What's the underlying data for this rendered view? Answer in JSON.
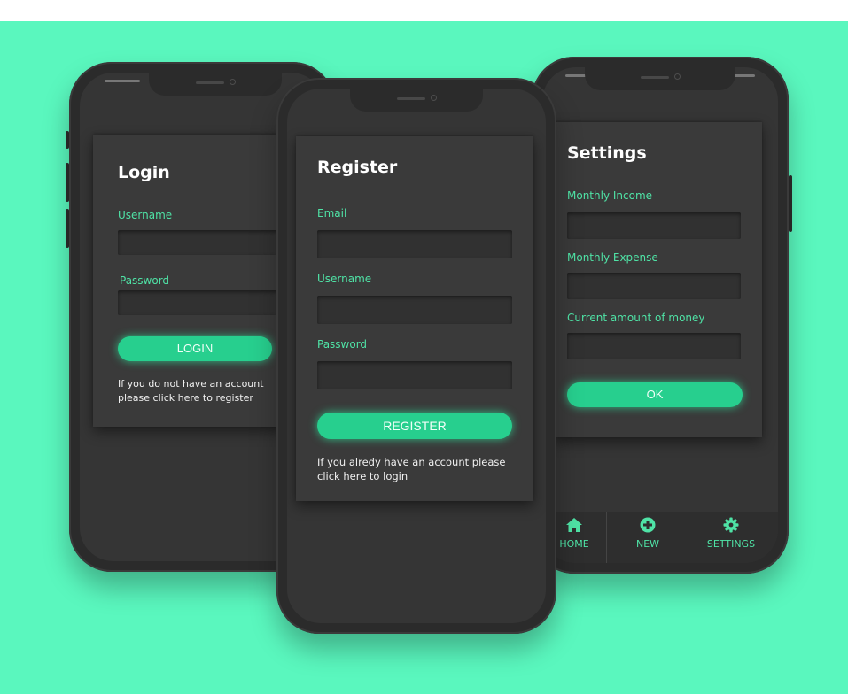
{
  "login": {
    "title": "Login",
    "username_label": "Username",
    "password_label": "Password",
    "button_label": "LOGIN",
    "hint_line1": "If you do not have an account",
    "hint_line2": "please click here to register"
  },
  "register": {
    "title": "Register",
    "email_label": "Email",
    "username_label": "Username",
    "password_label": "Password",
    "button_label": "REGISTER",
    "hint_line1": "If you alredy have an account please",
    "hint_line2": "click here to login"
  },
  "settings": {
    "title": "Settings",
    "income_label": "Monthly Income",
    "expense_label": "Monthly Expense",
    "money_label": "Current amount of money",
    "button_label": "OK"
  },
  "nav": {
    "items": [
      {
        "label": "HOME",
        "icon": "home-icon"
      },
      {
        "label": "NEW",
        "icon": "plus-circle-icon"
      },
      {
        "label": "SETTINGS",
        "icon": "gear-icon"
      }
    ]
  },
  "colors": {
    "background": "#5af7be",
    "accent": "#27cf8e",
    "label": "#4fe3a6",
    "phone": "#2b2b2b",
    "screen": "#353535"
  }
}
